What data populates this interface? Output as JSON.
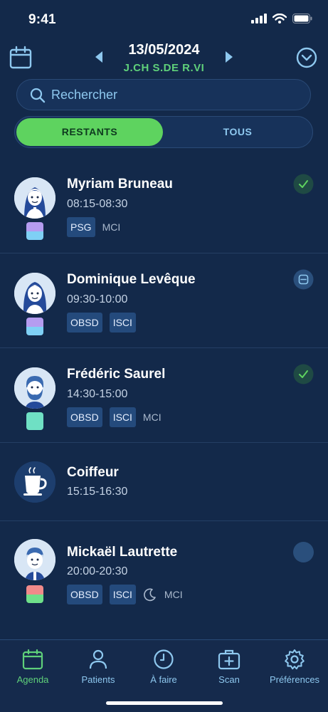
{
  "status_bar": {
    "time": "9:41"
  },
  "header": {
    "date": "13/05/2024",
    "initials": [
      "J.CH",
      "S.DE",
      "R.VI"
    ]
  },
  "search": {
    "placeholder": "Rechercher"
  },
  "segment": {
    "active": "RESTANTS",
    "other": "TOUS"
  },
  "appointments": [
    {
      "name": "Myriam Bruneau",
      "time": "08:15-08:30",
      "tags": [
        "PSG"
      ],
      "plain": [
        "MCI"
      ],
      "status": "done",
      "swatch": [
        "#b59cf0",
        "#7fd0f5"
      ],
      "avatar": "female-icon"
    },
    {
      "name": "Dominique Levêque",
      "time": "09:30-10:00",
      "tags": [
        "OBSD",
        "ISCI"
      ],
      "plain": [],
      "status": "minus",
      "swatch": [
        "#b59cf0",
        "#7fd0f5"
      ],
      "avatar": "female-icon"
    },
    {
      "name": "Frédéric Saurel",
      "time": "14:30-15:00",
      "tags": [
        "OBSD",
        "ISCI"
      ],
      "plain": [
        "MCI"
      ],
      "status": "done",
      "swatch": [
        "#6fe0c4",
        "#6fe0c4"
      ],
      "avatar": "bearded-male-icon"
    },
    {
      "name": "Coiffeur",
      "time": "15:15-16:30",
      "tags": [],
      "plain": [],
      "status": "none",
      "swatch": [],
      "avatar": "coffee-cup-icon"
    },
    {
      "name": "Mickaël Lautrette",
      "time": "20:00-20:30",
      "tags": [
        "OBSD",
        "ISCI"
      ],
      "plain": [
        "MCI"
      ],
      "status": "empty",
      "swatch": [
        "#f08a8a",
        "#6fe08a"
      ],
      "avatar": "male-icon",
      "moon": true
    }
  ],
  "tabs": [
    {
      "label": "Agenda",
      "icon": "calendar-icon",
      "active": true
    },
    {
      "label": "Patients",
      "icon": "person-icon",
      "active": false
    },
    {
      "label": "À faire",
      "icon": "clock-icon",
      "active": false
    },
    {
      "label": "Scan",
      "icon": "medical-case-icon",
      "active": false
    },
    {
      "label": "Préférences",
      "icon": "gear-icon",
      "active": false
    }
  ],
  "colors": {
    "accent_green": "#5ed35f",
    "accent_blue": "#8ec8ef",
    "background": "#13294a"
  }
}
